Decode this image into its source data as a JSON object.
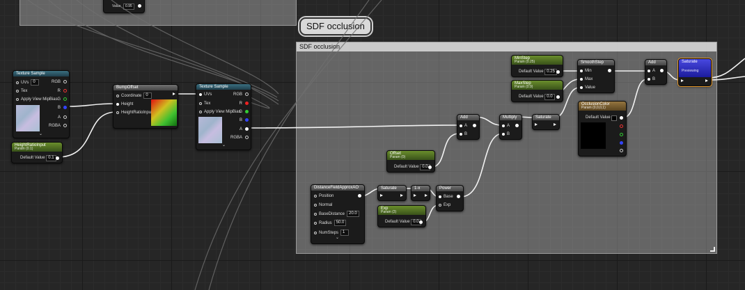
{
  "comment": {
    "bubble": "SDF occlusion",
    "header": "SDF occlusion"
  },
  "top_node": {
    "value_label": "Value",
    "value": "0.95"
  },
  "texture_sample_1": {
    "title": "Texture Sample",
    "uvs": "UVs",
    "uvs_value": "0",
    "tex": "Tex",
    "mip": "Apply View MipBias",
    "outputs": [
      "RGB",
      "R",
      "G",
      "B",
      "A",
      "RGBA"
    ]
  },
  "height_ratio": {
    "title": "HeightRatioInput",
    "subtitle": "Param (0.1)",
    "default_label": "Default Value",
    "default_value": "0.1"
  },
  "bump_offset": {
    "title": "BumpOffset",
    "coordinate": "Coordinate",
    "coordinate_value": "0",
    "height": "Height",
    "ratio": "HeightRatioInput"
  },
  "texture_sample_2": {
    "title": "Texture Sample",
    "uvs": "UVs",
    "tex": "Tex",
    "mip": "Apply View MipBias",
    "outputs": [
      "RGB",
      "R",
      "G",
      "B",
      "A",
      "RGBA"
    ]
  },
  "add_1": {
    "title": "Add",
    "a": "A",
    "b": "B"
  },
  "multiply": {
    "title": "Multiply",
    "a": "A",
    "b": "B"
  },
  "saturate_1": {
    "title": "Saturate"
  },
  "offset": {
    "title": "Offset",
    "subtitle": "Param (0)",
    "default_label": "Default Value",
    "default_value": "0.0"
  },
  "distance_field": {
    "title": "DistanceFieldApproxAO",
    "position": "Position",
    "normal": "Normal",
    "base_distance": "BaseDistance",
    "base_distance_value": "20.0",
    "radius": "Radius",
    "radius_value": "50.0",
    "num_steps": "NumSteps",
    "num_steps_value": "1"
  },
  "saturate_2": {
    "title": "Saturate"
  },
  "one_minus": {
    "title": "1-x"
  },
  "power": {
    "title": "Power",
    "base": "Base",
    "exp": "Exp"
  },
  "exp": {
    "title": "Exp",
    "subtitle": "Param (2)",
    "default_label": "Default Value",
    "default_value": "0.0"
  },
  "min_step": {
    "title": "MinStep",
    "subtitle": "Param (0.25)",
    "default_label": "Default Value",
    "default_value": "0.25"
  },
  "max_step": {
    "title": "MaxStep",
    "subtitle": "Param (0.9)",
    "default_label": "Default Value",
    "default_value": "0.0"
  },
  "smooth_step": {
    "title": "SmoothStep",
    "min": "Min",
    "max": "Max",
    "value": "Value"
  },
  "occlusion_color": {
    "title": "OcclusionColor",
    "subtitle": "Param (0,0,0,1)",
    "default_label": "Default Value"
  },
  "add_2": {
    "title": "Add",
    "a": "A",
    "b": "B"
  },
  "saturate_3": {
    "title": "Saturate",
    "subtitle": "Previewing"
  },
  "colors": {
    "accent_orange": "#e89a2a",
    "param_green": "#5d8628",
    "texture_teal": "#2f5b6b",
    "saturate_blue": "#2828c8",
    "vector_gold": "#8a6a30"
  }
}
